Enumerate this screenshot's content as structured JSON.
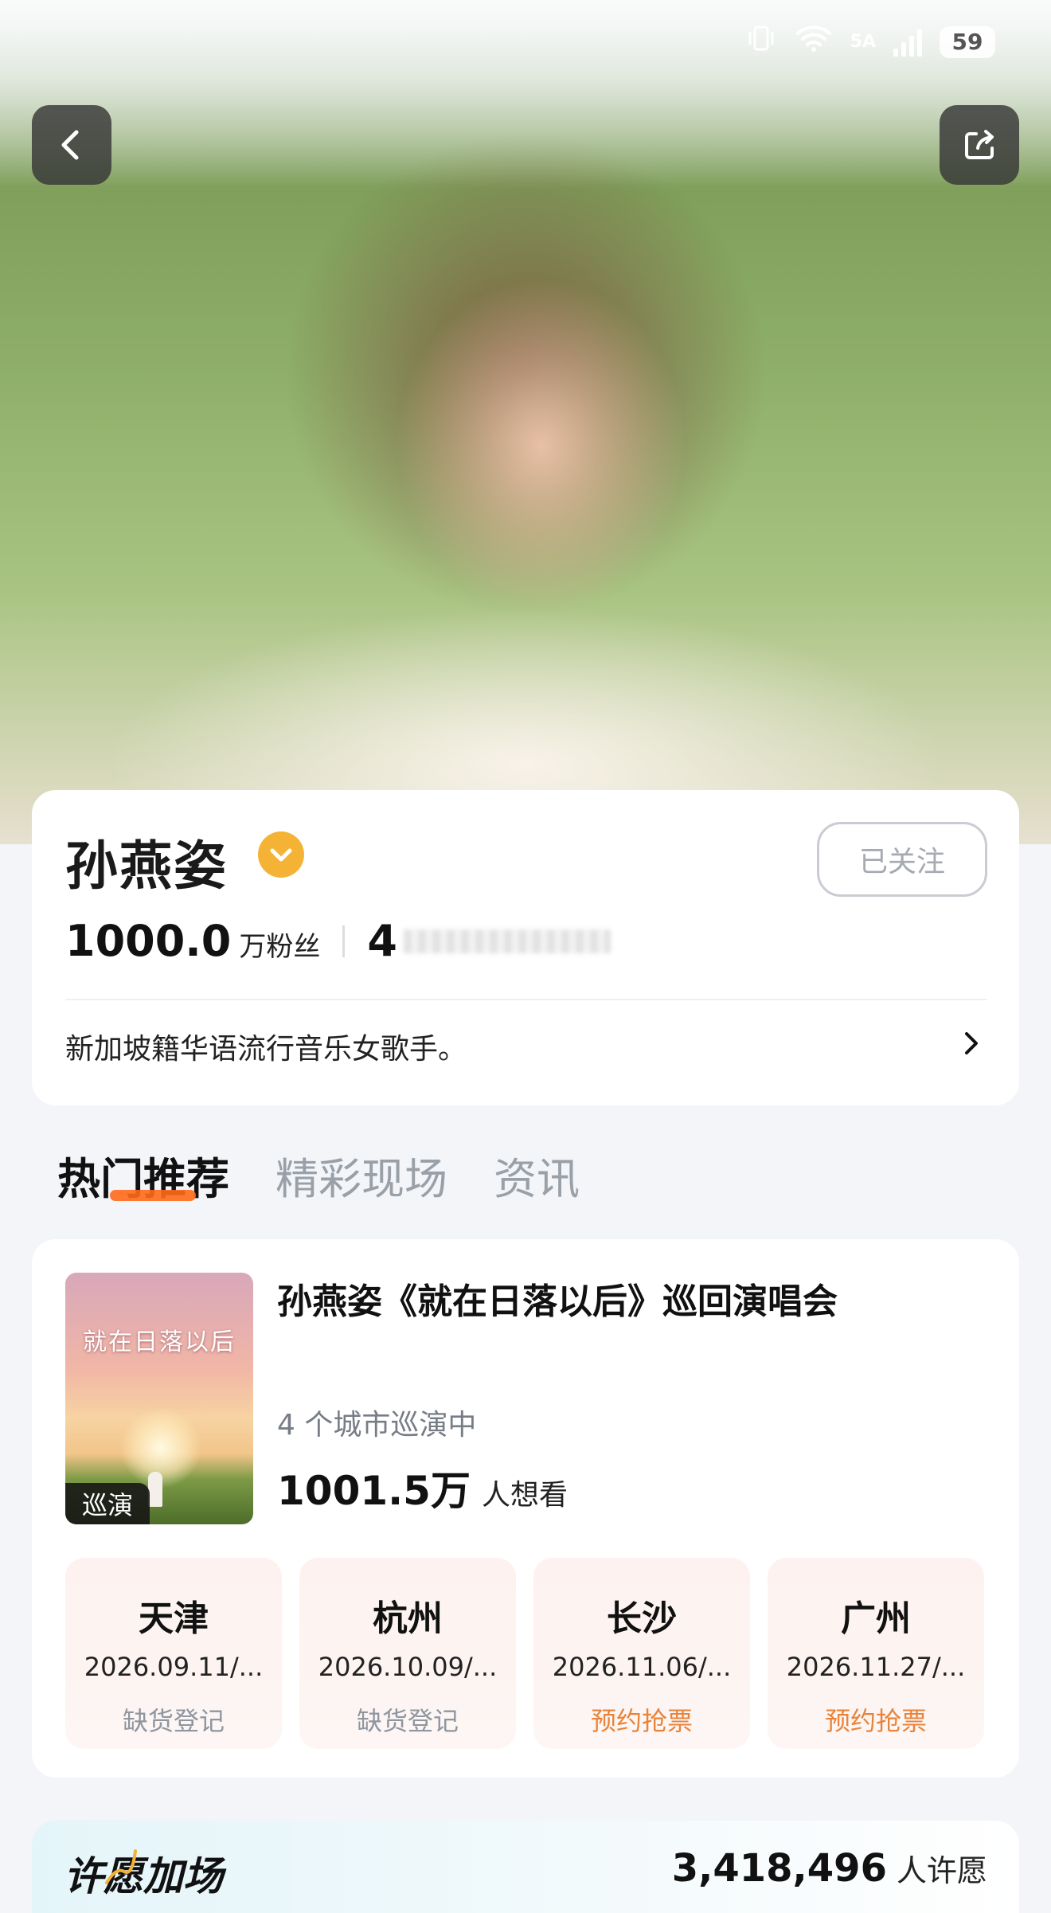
{
  "status_bar": {
    "network": "5A",
    "battery": "59"
  },
  "artist": {
    "name": "孙燕姿",
    "follow_label": "已关注",
    "fans_count": "1000.0",
    "fans_label": "万粉丝",
    "second_stat_visible": "4",
    "bio": "新加坡籍华语流行音乐女歌手。"
  },
  "tabs": [
    {
      "label": "热门推荐",
      "active": true
    },
    {
      "label": "精彩现场",
      "active": false
    },
    {
      "label": "资讯",
      "active": false
    }
  ],
  "event": {
    "poster_title": "就在日落以后",
    "badge": "巡演",
    "title": "孙燕姿《就在日落以后》巡回演唱会",
    "subtitle": "4 个城市巡演中",
    "want_count": "1001.5万",
    "want_label": "人想看",
    "cities": [
      {
        "name": "天津",
        "date": "2026.09.11/...",
        "status": "缺货登记",
        "status_type": "soldout"
      },
      {
        "name": "杭州",
        "date": "2026.10.09/...",
        "status": "缺货登记",
        "status_type": "soldout"
      },
      {
        "name": "长沙",
        "date": "2026.11.06/...",
        "status": "预约抢票",
        "status_type": "reserve"
      },
      {
        "name": "广州",
        "date": "2026.11.27/...",
        "status": "预约抢票",
        "status_type": "reserve"
      }
    ]
  },
  "wish": {
    "title": "许愿加场",
    "count": "3,418,496",
    "label": "人许愿"
  },
  "colors": {
    "accent_orange": "#ff6a1a",
    "verified_gold": "#f5b335",
    "reserve_orange": "#e9833a",
    "soldout_gray": "#8f96a0"
  },
  "icons": [
    "back-arrow-icon",
    "share-icon",
    "verified-icon",
    "chevron-right-icon",
    "vibrate-icon",
    "wifi-icon",
    "signal-icon",
    "battery-icon"
  ]
}
